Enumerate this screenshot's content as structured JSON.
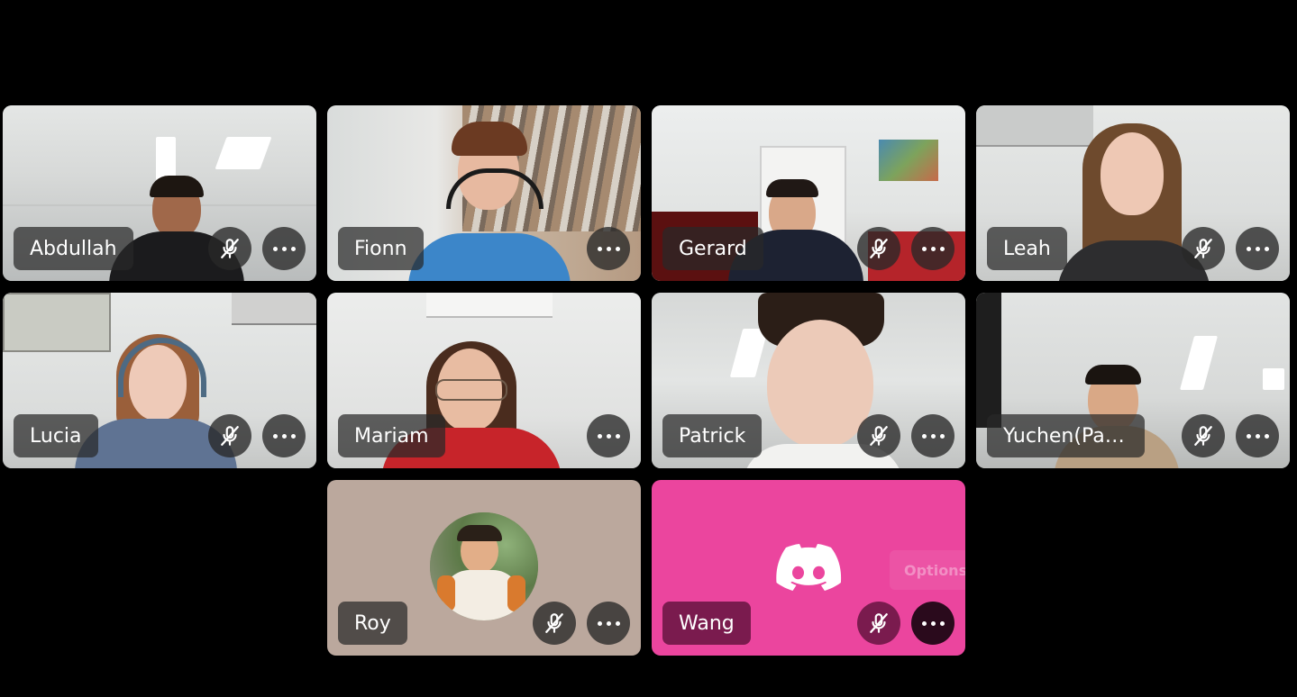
{
  "participants": [
    {
      "name": "Abdullah",
      "muted": true
    },
    {
      "name": "Fionn",
      "muted": false
    },
    {
      "name": "Gerard",
      "muted": true
    },
    {
      "name": "Leah",
      "muted": true
    },
    {
      "name": "Lucia",
      "muted": true
    },
    {
      "name": "Mariam",
      "muted": false
    },
    {
      "name": "Patrick",
      "muted": true
    },
    {
      "name": "Yuchen(Padd...",
      "muted": true
    },
    {
      "name": "Roy",
      "muted": true
    },
    {
      "name": "Wang",
      "muted": true
    }
  ],
  "wang_tile": {
    "options_label": "Options"
  },
  "icons": {
    "mute": "mic-off-icon",
    "more": "more-options-icon",
    "logo": "discord-logo-icon"
  },
  "colors": {
    "background": "#000000",
    "roy_tile_bg": "#bba89d",
    "wang_tile_bg": "#eb459e",
    "pill_bg": "#282828",
    "wang_pill_bg": "#6b1a44"
  }
}
